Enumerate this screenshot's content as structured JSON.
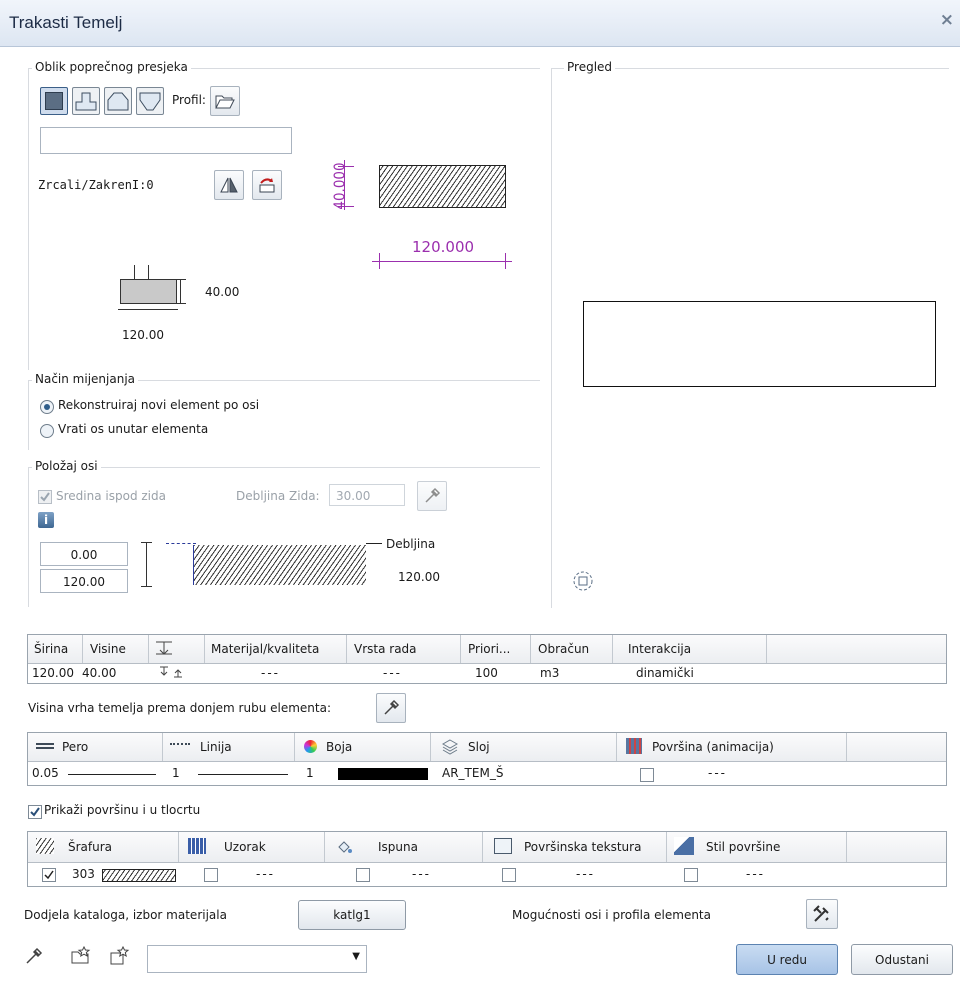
{
  "window": {
    "title": "Trakasti Temelj",
    "close": "×"
  },
  "cross_section": {
    "legend": "Oblik poprečnog presjeka",
    "profile_label": "Profil:",
    "profile_value": "",
    "mirror_label": "Zrcali/ZakrenI:0",
    "dim_height_small": "40.00",
    "dim_width_small": "120.00",
    "dim_height_purple": "40.000",
    "dim_width_purple": "120.000"
  },
  "preview": {
    "legend": "Pregled"
  },
  "change_mode": {
    "legend": "Način mijenjanja",
    "options": [
      "Rekonstruiraj novi element po osi",
      "Vrati os unutar elementa"
    ],
    "selected": 0
  },
  "axis_position": {
    "legend": "Položaj osi",
    "center_under_wall_label": "Sredina ispod zida",
    "wall_thickness_label": "Debljina Zida:",
    "wall_thickness_value": "30.00",
    "top_value": "0.00",
    "bottom_value": "120.00",
    "thickness_label": "Debljina",
    "thickness_value": "120.00"
  },
  "params_table": {
    "headers": [
      "Širina",
      "Visine",
      "",
      "Materijal/kvaliteta",
      "Vrsta rada",
      "Priori...",
      "Obračun",
      "Interakcija"
    ],
    "row": [
      "120.00",
      "40.00",
      "",
      "---",
      "---",
      "100",
      "m3",
      "dinamički"
    ]
  },
  "top_height_label": "Visina vrha temelja prema donjem rubu elementa:",
  "format_table": {
    "headers": [
      "Pero",
      "Linija",
      "Boja",
      "Sloj",
      "Površina (animacija)"
    ],
    "row": {
      "pen": "0.05",
      "line": "1",
      "color": "1",
      "layer": "AR_TEM_Š",
      "surface": "---"
    },
    "colors": {
      "swatch": "#000000"
    }
  },
  "show_surface_label": "Prikaži površinu i u tlocrtu",
  "surface_table": {
    "headers": [
      "Šrafura",
      "Uzorak",
      "Ispuna",
      "Površinska tekstura",
      "Stil površine"
    ],
    "hatch_value": "303",
    "dashes": [
      "---",
      "---",
      "---",
      "---"
    ]
  },
  "catalog": {
    "label": "Dodjela kataloga, izbor materijala",
    "button": "katlg1"
  },
  "axis_options_label": "Mogućnosti osi i profila elementa",
  "footer": {
    "ok": "U redu",
    "cancel": "Odustani",
    "combo_value": ""
  },
  "colors": {
    "accent_purple": "#9b2fae",
    "title_bg": "#dde6f2"
  }
}
